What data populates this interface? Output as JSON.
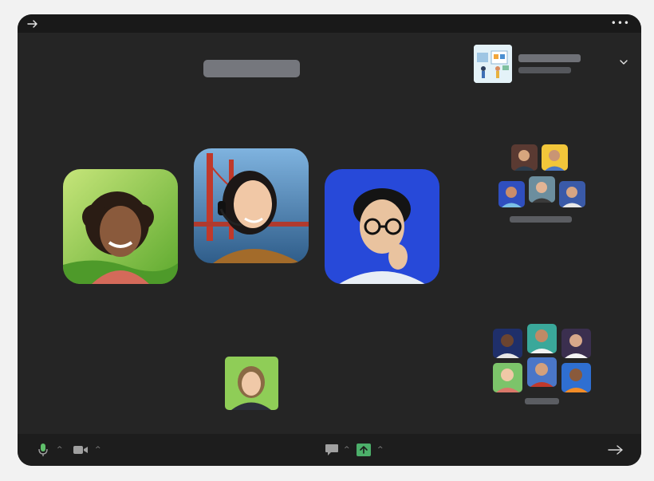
{
  "window": {
    "back_icon": "arrow-right-icon",
    "menu_label": "•••"
  },
  "header": {
    "room_thumb_icon": "room-illustration-icon",
    "expand_icon": "chevron-down-icon"
  },
  "stage": {
    "participants": [
      {
        "id": "participant-curly-hair-green-bg",
        "bg": "#8bc34a"
      },
      {
        "id": "participant-headset-golden-gate",
        "bg": "#4a82b8"
      },
      {
        "id": "participant-glasses-blue-bg",
        "bg": "#2548d8"
      }
    ]
  },
  "breakout_groups": [
    {
      "id": "group-top",
      "members": 5
    },
    {
      "id": "group-bottom",
      "members": 6
    }
  ],
  "toolbar": {
    "mic_icon": "microphone-icon",
    "camera_icon": "video-camera-icon",
    "chat_icon": "chat-bubble-icon",
    "share_icon": "share-screen-icon",
    "leave_icon": "arrow-right-icon",
    "accent": "#4caf6a"
  }
}
